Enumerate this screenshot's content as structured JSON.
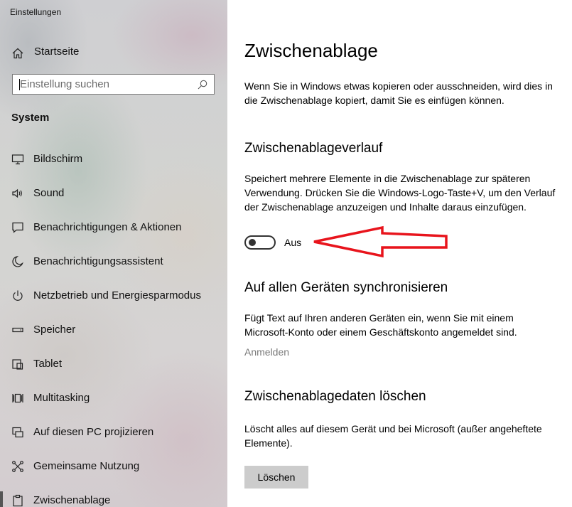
{
  "window": {
    "title": "Einstellungen"
  },
  "sidebar": {
    "home_label": "Startseite",
    "search": {
      "placeholder": "Einstellung suchen",
      "value": ""
    },
    "section_title": "System",
    "items": [
      {
        "label": "Bildschirm",
        "icon": "monitor-icon"
      },
      {
        "label": "Sound",
        "icon": "speaker-icon"
      },
      {
        "label": "Benachrichtigungen & Aktionen",
        "icon": "notification-icon"
      },
      {
        "label": "Benachrichtigungsassistent",
        "icon": "moon-icon"
      },
      {
        "label": "Netzbetrieb und Energiesparmodus",
        "icon": "power-icon"
      },
      {
        "label": "Speicher",
        "icon": "storage-icon"
      },
      {
        "label": "Tablet",
        "icon": "tablet-icon"
      },
      {
        "label": "Multitasking",
        "icon": "multitasking-icon"
      },
      {
        "label": "Auf diesen PC projizieren",
        "icon": "project-icon"
      },
      {
        "label": "Gemeinsame Nutzung",
        "icon": "share-icon"
      },
      {
        "label": "Zwischenablage",
        "icon": "clipboard-icon",
        "active": true
      }
    ]
  },
  "main": {
    "title": "Zwischenablage",
    "intro": "Wenn Sie in Windows etwas kopieren oder ausschneiden, wird dies in die Zwischenablage kopiert, damit Sie es einfügen können.",
    "history": {
      "heading": "Zwischenablageverlauf",
      "description": "Speichert mehrere Elemente in die Zwischenablage zur späteren Verwendung. Drücken Sie die Windows-Logo-Taste+V, um den Verlauf der Zwischenablage anzuzeigen und Inhalte daraus einzufügen.",
      "toggle_state": "Aus",
      "toggle_on": false
    },
    "sync": {
      "heading": "Auf allen Geräten synchronisieren",
      "description": "Fügt Text auf Ihren anderen Geräten ein, wenn Sie mit einem Microsoft-Konto oder einem Geschäftskonto angemeldet sind.",
      "link": "Anmelden"
    },
    "clear": {
      "heading": "Zwischenablagedaten löschen",
      "description": "Löscht alles auf diesem Gerät und bei Microsoft (außer angeheftete Elemente).",
      "button": "Löschen"
    }
  },
  "colors": {
    "annotation_arrow": "#e8141c",
    "button_bg": "#cccccc",
    "disabled_link": "#7a7a7a"
  }
}
